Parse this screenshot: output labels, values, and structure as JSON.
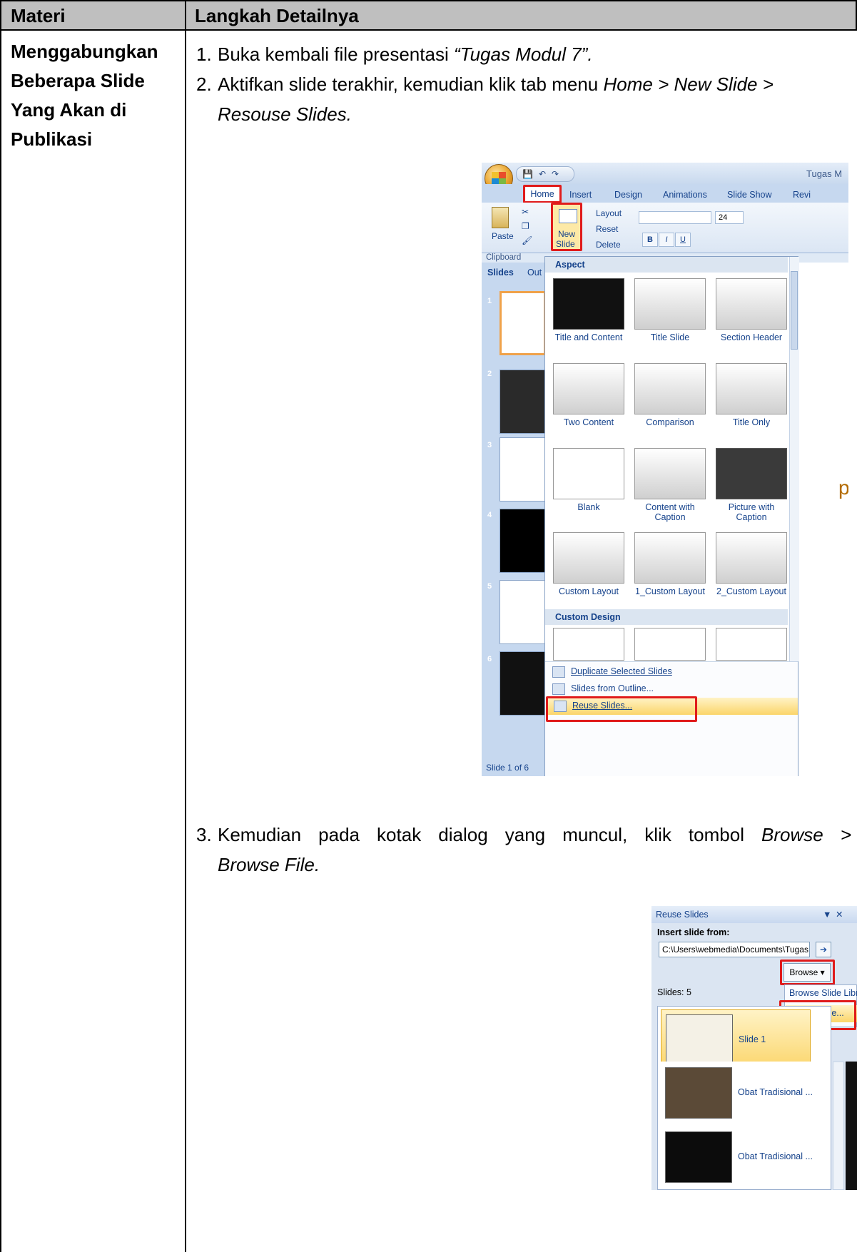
{
  "table": {
    "header_materi": "Materi",
    "header_langkah": "Langkah Detailnya",
    "materi_title": "Menggabungkan Beberapa Slide Yang Akan di Publikasi"
  },
  "steps": [
    {
      "num": "1.",
      "text": "Buka kembali file presentasi ",
      "emph": "“Tugas Modul 7”."
    },
    {
      "num": "2.",
      "line1_text": "Aktifkan slide terakhir, kemudian klik tab menu ",
      "line1_emph": "Home > New Slide >",
      "line2_emph": "Resouse Slides."
    },
    {
      "num": "3.",
      "line1_text": "Kemudian pada kotak dialog yang muncul, klik tombol ",
      "line1_emph": "Browse >",
      "line2_emph": "Browse File."
    }
  ],
  "ppt": {
    "app_title": "Tugas M",
    "tabs": [
      "Home",
      "Insert",
      "Design",
      "Animations",
      "Slide Show",
      "Revi"
    ],
    "ribbon": {
      "paste": "Paste",
      "new_slide_1": "New",
      "new_slide_2": "Slide",
      "layout": "Layout",
      "reset": "Reset",
      "delete": "Delete",
      "font_size": "24",
      "clipboard": "Clipboard"
    },
    "pane_tabs": [
      "Slides",
      "Out"
    ],
    "status": "Slide 1 of 6",
    "thumb_nums": [
      "1",
      "2",
      "3",
      "4",
      "5",
      "6"
    ],
    "gallery": {
      "section_aspect": "Aspect",
      "section_custom": "Custom Design",
      "layouts": [
        "Title and Content",
        "Title Slide",
        "Section Header",
        "Two Content",
        "Comparison",
        "Title Only",
        "Blank",
        "Content with Caption",
        "Picture with Caption",
        "Custom Layout",
        "1_Custom Layout",
        "2_Custom Layout"
      ],
      "menu": [
        "Duplicate Selected Slides",
        "Slides from Outline...",
        "Reuse Slides..."
      ]
    }
  },
  "reuse_pane": {
    "title": "Reuse Slides",
    "insert_from": "Insert slide from:",
    "path": "C:\\Users\\webmedia\\Documents\\Tugas Mo",
    "browse": "Browse",
    "slides_count": "Slides: 5",
    "dropdown": [
      "Browse Slide Library...",
      "Browse File..."
    ],
    "items": [
      "Slide 1",
      "Obat Tradisional ...",
      "Obat Tradisional ..."
    ]
  }
}
